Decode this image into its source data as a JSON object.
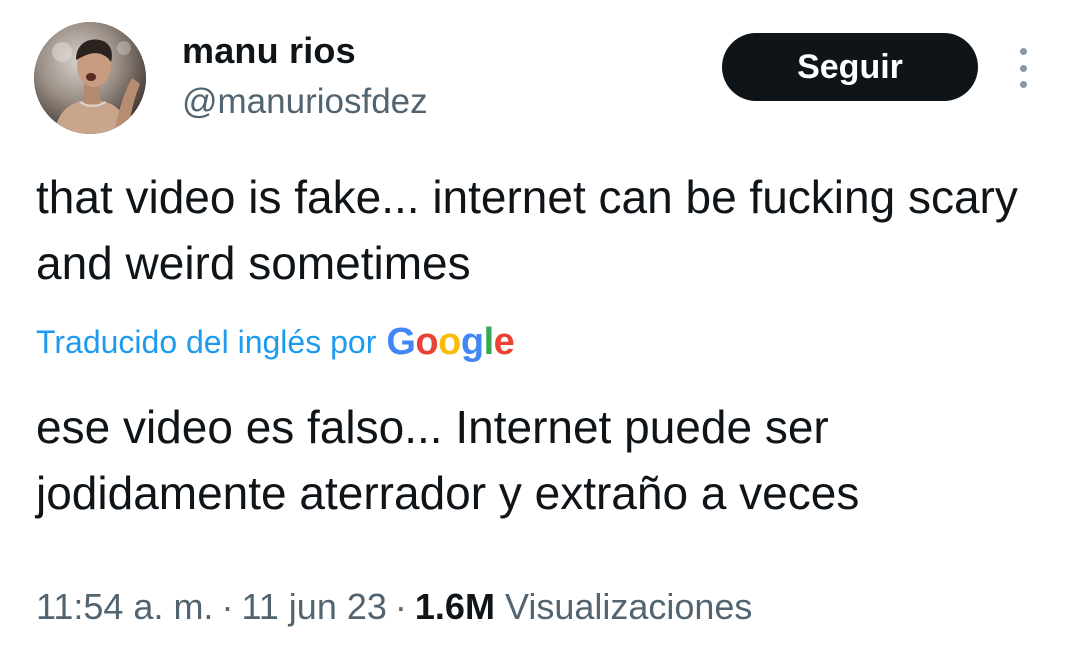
{
  "user": {
    "display_name": "manu rios",
    "handle": "@manuriosfdez"
  },
  "actions": {
    "follow_label": "Seguir",
    "more_icon": "more-vertical-icon"
  },
  "tweet": {
    "text": "that video is fake... internet can be fucking scary and weird sometimes",
    "translation_label": "Traducido del inglés por",
    "translation_provider": {
      "name": "Google",
      "letters": [
        "G",
        "o",
        "o",
        "g",
        "l",
        "e"
      ],
      "colors": [
        "#4285f4",
        "#ea4335",
        "#fbbc05",
        "#4285f4",
        "#34a853",
        "#ea4335"
      ]
    },
    "translated_text": "ese video es falso... Internet puede ser jodidamente aterrador y extraño a veces"
  },
  "meta": {
    "time": "11:54 a. m.",
    "date": "11 jun 23",
    "separator": "·",
    "views_count": "1.6M",
    "views_label": "Visualizaciones"
  },
  "colors": {
    "text_primary": "#0f1419",
    "text_secondary": "#536471",
    "link": "#1d9bf0",
    "follow_bg": "#0f1419",
    "follow_text": "#ffffff"
  }
}
